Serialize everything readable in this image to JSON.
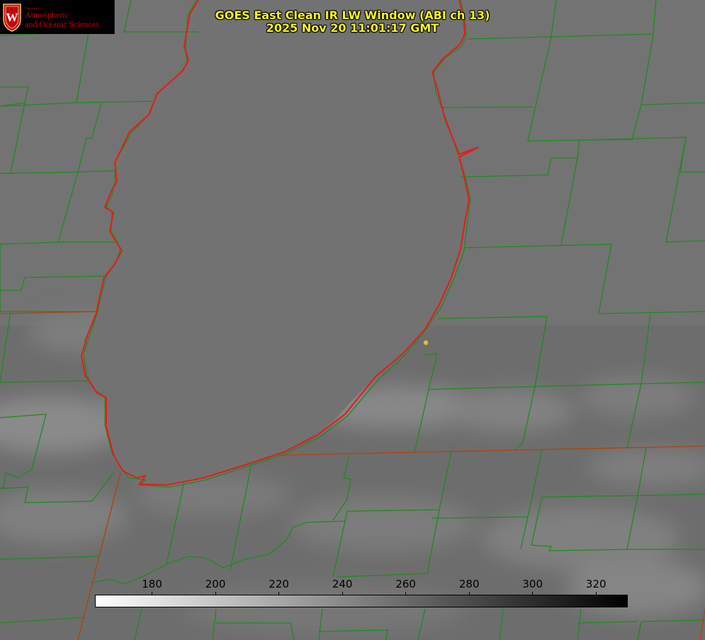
{
  "title_line1": "GOES East Clean IR LW Window (ABI ch 13)",
  "title_line2": "2025 Nov 20 11:01:17 GMT",
  "logo": {
    "department": "Department of",
    "line1": "Atmospheric",
    "line2": "and Oceanic Sciences",
    "crest_letter": "W"
  },
  "colorbar": {
    "ticks": [
      "180",
      "200",
      "220",
      "240",
      "260",
      "280",
      "300",
      "320"
    ],
    "tick_values": [
      180,
      200,
      220,
      240,
      260,
      280,
      300,
      320
    ],
    "value_range": [
      162,
      330
    ],
    "low_color": "#ffffff",
    "high_color": "#000000"
  },
  "colors": {
    "county_lines": "#1f8a1f",
    "state_lines": "#b8401a",
    "lake_outline": "#e81a1a",
    "title_text": "#f5f51e",
    "station_marker": "#d4c820"
  },
  "features": {
    "lake": "Lake Michigan",
    "station_marker": "yellow-dot"
  }
}
